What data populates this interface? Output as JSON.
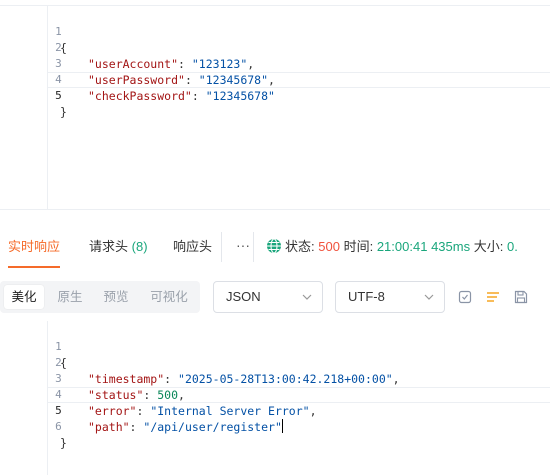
{
  "request_body": {
    "lines": [
      {
        "n": "1",
        "open": "{"
      },
      {
        "n": "2",
        "key": "\"userAccount\"",
        "value": "\"123123\"",
        "tail": ","
      },
      {
        "n": "3",
        "key": "\"userPassword\"",
        "value": "\"12345678\"",
        "tail": ","
      },
      {
        "n": "4",
        "key": "\"checkPassword\"",
        "value": "\"12345678\"",
        "tail": ""
      },
      {
        "n": "5",
        "close": "}"
      }
    ]
  },
  "tabs": {
    "realtime": "实时响应",
    "headers": "请求头",
    "headers_count": "(8)",
    "resp_headers": "响应头",
    "more": "···"
  },
  "status_bar": {
    "status_label": "状态:",
    "status_value": "500",
    "time_label": "时间:",
    "time_value": "21:00:41",
    "duration": "435ms",
    "size_label": "大小:",
    "size_value": "0."
  },
  "view_modes": {
    "pretty": "美化",
    "raw": "原生",
    "preview": "预览",
    "visualize": "可视化"
  },
  "format_select": {
    "value": "JSON"
  },
  "encoding_select": {
    "value": "UTF-8"
  },
  "response_body": {
    "lines": [
      {
        "n": "1",
        "open": "{"
      },
      {
        "n": "2",
        "key": "\"timestamp\"",
        "value": "\"2025-05-28T13:00:42.218+00:00\"",
        "tail": ","
      },
      {
        "n": "3",
        "key": "\"status\"",
        "value": "500",
        "tail": ","
      },
      {
        "n": "4",
        "key": "\"error\"",
        "value": "\"Internal Server Error\"",
        "tail": ","
      },
      {
        "n": "5",
        "key": "\"path\"",
        "value": "\"/api/user/register\"",
        "tail": ""
      },
      {
        "n": "6",
        "close": "}"
      }
    ]
  },
  "colors": {
    "accent": "#f56b2a",
    "success": "#1aa67c",
    "error": "#f0523d",
    "json_key": "#a31515",
    "json_string": "#0451a5",
    "json_number": "#098658"
  },
  "icons": {
    "status": "globe-icon",
    "copy": "copy-check-icon",
    "format": "format-lines-icon",
    "save": "save-icon",
    "dropdown": "chevron-down-icon"
  }
}
